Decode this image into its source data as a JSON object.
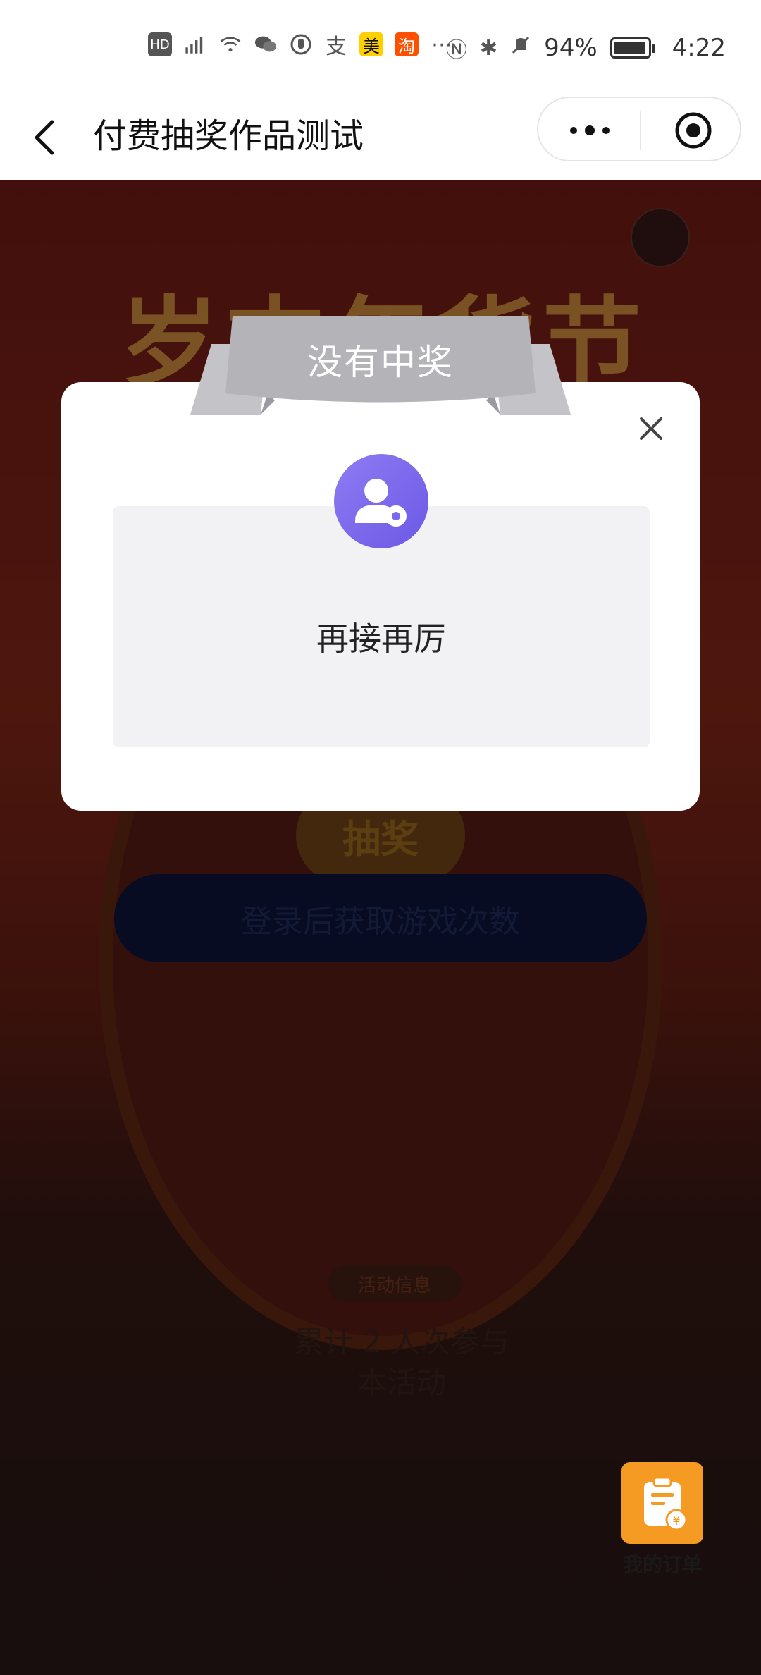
{
  "status_bar": {
    "battery": "94%",
    "time": "4:22",
    "left_icons": [
      "hd-icon",
      "signal-4g-icon",
      "wifi-icon",
      "wechat-icon",
      "hand-icon",
      "alipay-icon",
      "meituan-icon",
      "taobao-icon",
      "more-dots-icon"
    ],
    "right_icons": [
      "nfc-icon",
      "bluetooth-icon",
      "mute-icon"
    ]
  },
  "navbar": {
    "title": "付费抽奖作品测试"
  },
  "background_page": {
    "banner": "岁末年货节",
    "lottery_button": "抽奖",
    "login_button": "登录后获取游戏次数",
    "info_badge": "活动信息",
    "info_text_line1": "累计 2 人次参与",
    "info_text_line2": "本活动"
  },
  "modal": {
    "title": "没有中奖",
    "message": "再接再厉",
    "accent_color": "#7a68ee"
  },
  "floating": {
    "order_label": "我的订单"
  }
}
